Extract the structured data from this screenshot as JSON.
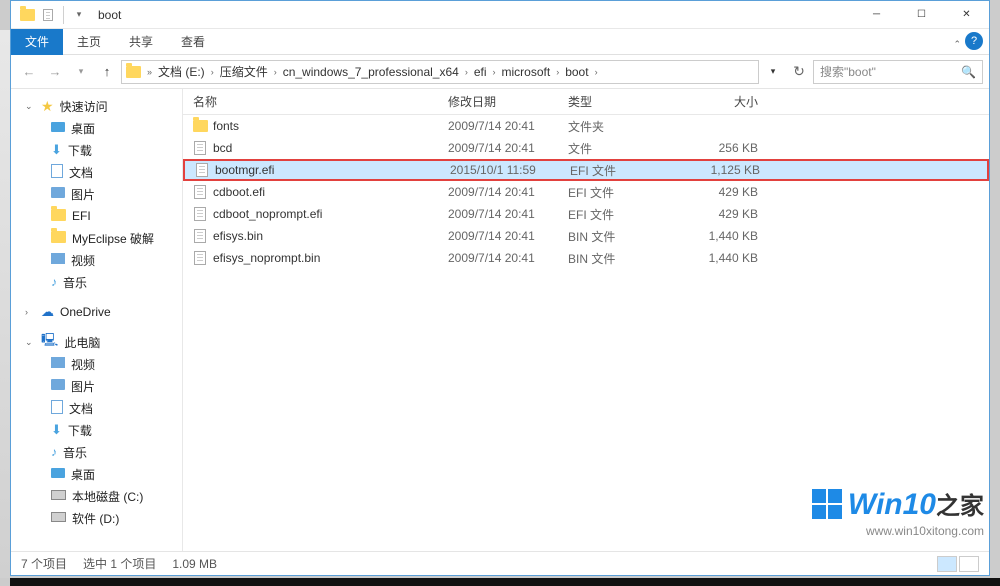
{
  "window_title": "boot",
  "tabs": {
    "file": "文件",
    "home": "主页",
    "share": "共享",
    "view": "查看"
  },
  "breadcrumbs": [
    "«",
    "文档 (E:)",
    "压缩文件",
    "cn_windows_7_professional_x64",
    "efi",
    "microsoft",
    "boot"
  ],
  "search": {
    "placeholder": "搜索\"boot\""
  },
  "sidebar": {
    "quick": "快速访问",
    "quick_items": [
      {
        "label": "桌面",
        "icon": "desktop"
      },
      {
        "label": "下载",
        "icon": "download"
      },
      {
        "label": "文档",
        "icon": "document"
      },
      {
        "label": "图片",
        "icon": "picture"
      },
      {
        "label": "EFI",
        "icon": "folder"
      },
      {
        "label": "MyEclipse 破解",
        "icon": "folder"
      },
      {
        "label": "视频",
        "icon": "video"
      },
      {
        "label": "音乐",
        "icon": "music"
      }
    ],
    "onedrive": "OneDrive",
    "thispc": "此电脑",
    "pc_items": [
      {
        "label": "视频",
        "icon": "video"
      },
      {
        "label": "图片",
        "icon": "picture"
      },
      {
        "label": "文档",
        "icon": "document"
      },
      {
        "label": "下载",
        "icon": "download"
      },
      {
        "label": "音乐",
        "icon": "music"
      },
      {
        "label": "桌面",
        "icon": "desktop"
      },
      {
        "label": "本地磁盘 (C:)",
        "icon": "drive"
      },
      {
        "label": "软件 (D:)",
        "icon": "drive"
      }
    ]
  },
  "columns": {
    "name": "名称",
    "date": "修改日期",
    "type": "类型",
    "size": "大小"
  },
  "files": [
    {
      "name": "fonts",
      "date": "2009/7/14 20:41",
      "type": "文件夹",
      "size": "",
      "icon": "folder"
    },
    {
      "name": "bcd",
      "date": "2009/7/14 20:41",
      "type": "文件",
      "size": "256 KB",
      "icon": "file"
    },
    {
      "name": "bootmgr.efi",
      "date": "2015/10/1 11:59",
      "type": "EFI 文件",
      "size": "1,125 KB",
      "icon": "file",
      "highlight": true
    },
    {
      "name": "cdboot.efi",
      "date": "2009/7/14 20:41",
      "type": "EFI 文件",
      "size": "429 KB",
      "icon": "file"
    },
    {
      "name": "cdboot_noprompt.efi",
      "date": "2009/7/14 20:41",
      "type": "EFI 文件",
      "size": "429 KB",
      "icon": "file"
    },
    {
      "name": "efisys.bin",
      "date": "2009/7/14 20:41",
      "type": "BIN 文件",
      "size": "1,440 KB",
      "icon": "file"
    },
    {
      "name": "efisys_noprompt.bin",
      "date": "2009/7/14 20:41",
      "type": "BIN 文件",
      "size": "1,440 KB",
      "icon": "file"
    }
  ],
  "status": {
    "items": "7 个项目",
    "selected": "选中 1 个项目",
    "size": "1.09 MB"
  },
  "watermark": {
    "brand_eng": "Win10",
    "brand_cn": "之家",
    "url": "www.win10xitong.com"
  }
}
